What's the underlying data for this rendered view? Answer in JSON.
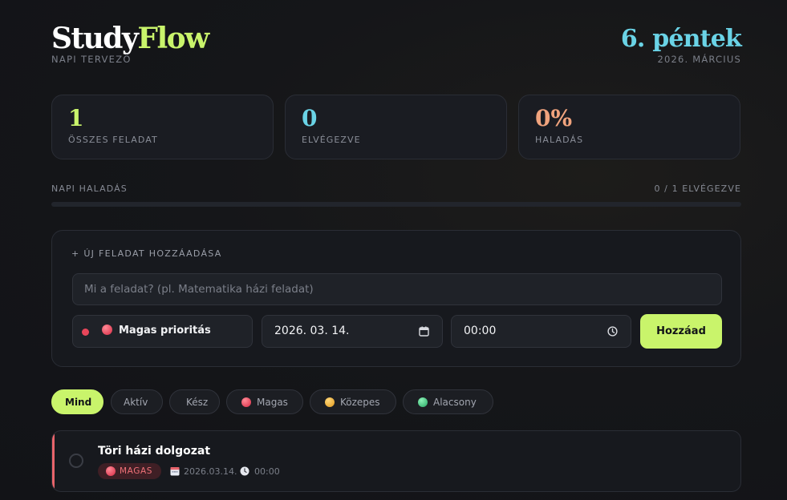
{
  "header": {
    "logo_part1": "Study",
    "logo_part2": "Flow",
    "subtitle": "NAPI TERVEZŐ",
    "date_main": "6. péntek",
    "date_sub": "2026. MÁRCIUS"
  },
  "stats": [
    {
      "value": "1",
      "label": "ÖSSZES FELADAT",
      "color": "#c9f46b"
    },
    {
      "value": "0",
      "label": "ELVÉGEZVE",
      "color": "#6ad3e6"
    },
    {
      "value": "0%",
      "label": "HALADÁS",
      "color": "#f0a37d"
    }
  ],
  "progress": {
    "label": "NAPI HALADÁS",
    "count_text": "0 / 1 ELVÉGEZVE",
    "fraction": 0
  },
  "add_task": {
    "title": "+ ÚJ FELADAT HOZZÁADÁSA",
    "placeholder": "Mi a feladat? (pl. Matematika házi feladat)",
    "priority_label": "Magas prioritás",
    "date_value": "2026. 03. 14.",
    "time_value": "00:00",
    "submit_label": "Hozzáad"
  },
  "filters": [
    {
      "label": "Mind",
      "active": true
    },
    {
      "label": "Aktív",
      "active": false
    },
    {
      "label": "Kész",
      "active": false
    },
    {
      "label": "Magas",
      "active": false,
      "dot": "#e8465a"
    },
    {
      "label": "Közepes",
      "active": false,
      "dot": "#f2b02e"
    },
    {
      "label": "Alacsony",
      "active": false,
      "dot": "#3ec97c"
    }
  ],
  "tasks": [
    {
      "title": "Töri házi dolgozat",
      "priority": "MAGAS",
      "date": "2026.03.14.",
      "time": "00:00",
      "done": false
    }
  ],
  "colors": {
    "accent": "#c9f46b",
    "cyan": "#6ad3e6",
    "orange": "#f0a37d",
    "high": "#e8465a",
    "medium": "#f2b02e",
    "low": "#3ec97c"
  },
  "icons": [
    "red-dot-icon",
    "priority-high-icon",
    "calendar-icon",
    "clock-icon",
    "checkbox-icon"
  ]
}
